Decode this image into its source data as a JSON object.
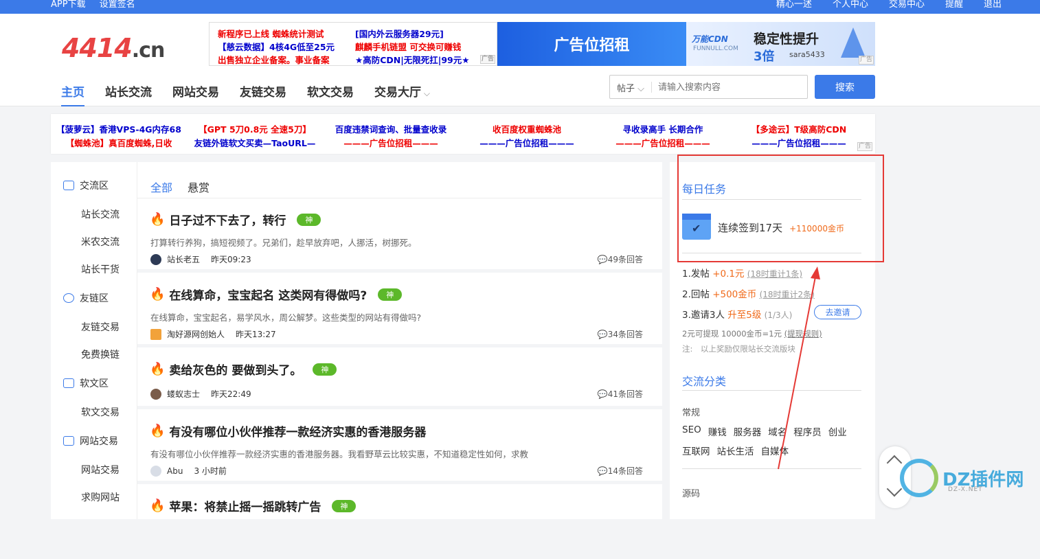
{
  "topbar": {
    "left": [
      "APP下载",
      "设置签名"
    ],
    "right": [
      "精心一述",
      "个人中心",
      "交易中心",
      "提醒",
      "退出"
    ]
  },
  "logo": {
    "main": "4414",
    "tld": ".cn"
  },
  "ads_top": {
    "lines": [
      {
        "text": "新程序已上线 蜘蛛统计测试",
        "color": "#e00"
      },
      {
        "text": "[国内外云服务器29元]",
        "color": "#00c"
      },
      {
        "text": "【慈云数据】4核4G低至25元",
        "color": "#00c"
      },
      {
        "text": "麒麟手机链盟 可交换可赚钱",
        "color": "#e00"
      },
      {
        "text": "出售独立企业备案。事业备案",
        "color": "#e00"
      },
      {
        "text": "★高防CDN|无限死扛|99元★",
        "color": "#00c"
      }
    ],
    "mark": "广告",
    "blue_ad": "广告位招租",
    "cdn": {
      "brand": "万能CDN",
      "domain": "FUNNULL.COM",
      "title": "稳定性提升",
      "multiple": "3倍",
      "user": "sara5433"
    }
  },
  "nav": {
    "items": [
      "主页",
      "站长交流",
      "网站交易",
      "友链交易",
      "软文交易",
      "交易大厅"
    ]
  },
  "search": {
    "scope": "帖子",
    "placeholder": "请输入搜索内容",
    "button": "搜索"
  },
  "adbar": {
    "cells": [
      {
        "text": "【菠萝云】香港VPS-4G内存68",
        "color": "#00c"
      },
      {
        "text": "【GPT 5刀0.8元 全速5刀】",
        "color": "#e00"
      },
      {
        "text": "百度违禁词查询、批量查收录",
        "color": "#00c"
      },
      {
        "text": "收百度权重蜘蛛池",
        "color": "#e00"
      },
      {
        "text": "寻收录高手 长期合作",
        "color": "#00c"
      },
      {
        "text": "【多途云】T级高防CDN",
        "color": "#e00"
      },
      {
        "text": "【蜘蛛池】真百度蜘蛛,日收",
        "color": "#e00"
      },
      {
        "text": "友链外链软文买卖—TaoURL—",
        "color": "#00c"
      },
      {
        "text": "———广告位招租———",
        "color": "#e00"
      },
      {
        "text": "———广告位招租———",
        "color": "#00c"
      },
      {
        "text": "———广告位招租———",
        "color": "#e00"
      },
      {
        "text": "———广告位招租———",
        "color": "#00c"
      }
    ]
  },
  "leftnav": {
    "sections": [
      {
        "label": "交流区",
        "items": [
          "站长交流",
          "米农交流",
          "站长干货"
        ]
      },
      {
        "label": "友链区",
        "items": [
          "友链交易",
          "免费换链"
        ]
      },
      {
        "label": "软文区",
        "items": [
          "软文交易"
        ]
      },
      {
        "label": "网站交易",
        "items": [
          "网站交易",
          "求购网站"
        ]
      }
    ]
  },
  "tabs": [
    "全部",
    "悬赏"
  ],
  "posts": [
    {
      "title": "日子过不下去了，转行",
      "badge": "神",
      "desc": "打算转行养狗，搞短视频了。兄弟们，趁早放弃吧，人挪活，树挪死。",
      "author": "站长老五",
      "time": "昨天09:23",
      "replies": "49条回答"
    },
    {
      "title": "在线算命，宝宝起名 这类网有得做吗?",
      "badge": "神",
      "desc": "在线算命，宝宝起名，易学风水，周公解梦。这些类型的网站有得做吗?",
      "author": "淘好源网创始人",
      "time": "昨天13:27",
      "replies": "34条回答"
    },
    {
      "title": "卖给灰色的 要做到头了。",
      "badge": "神",
      "desc": "",
      "author": "蝼蚁志士",
      "time": "昨天22:49",
      "replies": "41条回答"
    },
    {
      "title": "有没有哪位小伙伴推荐一款经济实惠的香港服务器",
      "badge": "",
      "desc": "有没有哪位小伙伴推荐一款经济实惠的香港服务器。我看野草云比较实惠，不知道稳定性如何，求教",
      "author": "Abu",
      "time": "3 小时前",
      "replies": "14条回答"
    },
    {
      "title": "苹果：将禁止摇一摇跳转广告",
      "badge": "神",
      "desc": "",
      "author": "",
      "time": "",
      "replies": ""
    }
  ],
  "side": {
    "daily_title": "每日任务",
    "checkin": "连续签到17天",
    "checkin_reward": "+110000金币",
    "tasks": [
      {
        "label": "1.发帖",
        "reward": "+0.1元",
        "note": "(18时重计1条)"
      },
      {
        "label": "2.回帖",
        "reward": "+500金币",
        "note": "(18时重计2条)"
      },
      {
        "label": "3.邀请3人",
        "reward": "升至5级",
        "note": "(1/3人)"
      }
    ],
    "invite_button": "去邀请",
    "exchange": "2元可提现 10000金币=1元",
    "exchange_rule": "(提现规则)",
    "notice": "注:　以上奖励仅限站长交流版块",
    "cat_title": "交流分类",
    "cat_group": "常规",
    "cats_row1": [
      "SEO",
      "赚钱",
      "服务器",
      "域名",
      "程序员",
      "创业"
    ],
    "cats_row2": [
      "互联网",
      "站长生活",
      "自媒体"
    ],
    "cat_group2": "源码"
  },
  "watermark": {
    "text": "DZ插件网",
    "url": "DZ-X.NET"
  }
}
